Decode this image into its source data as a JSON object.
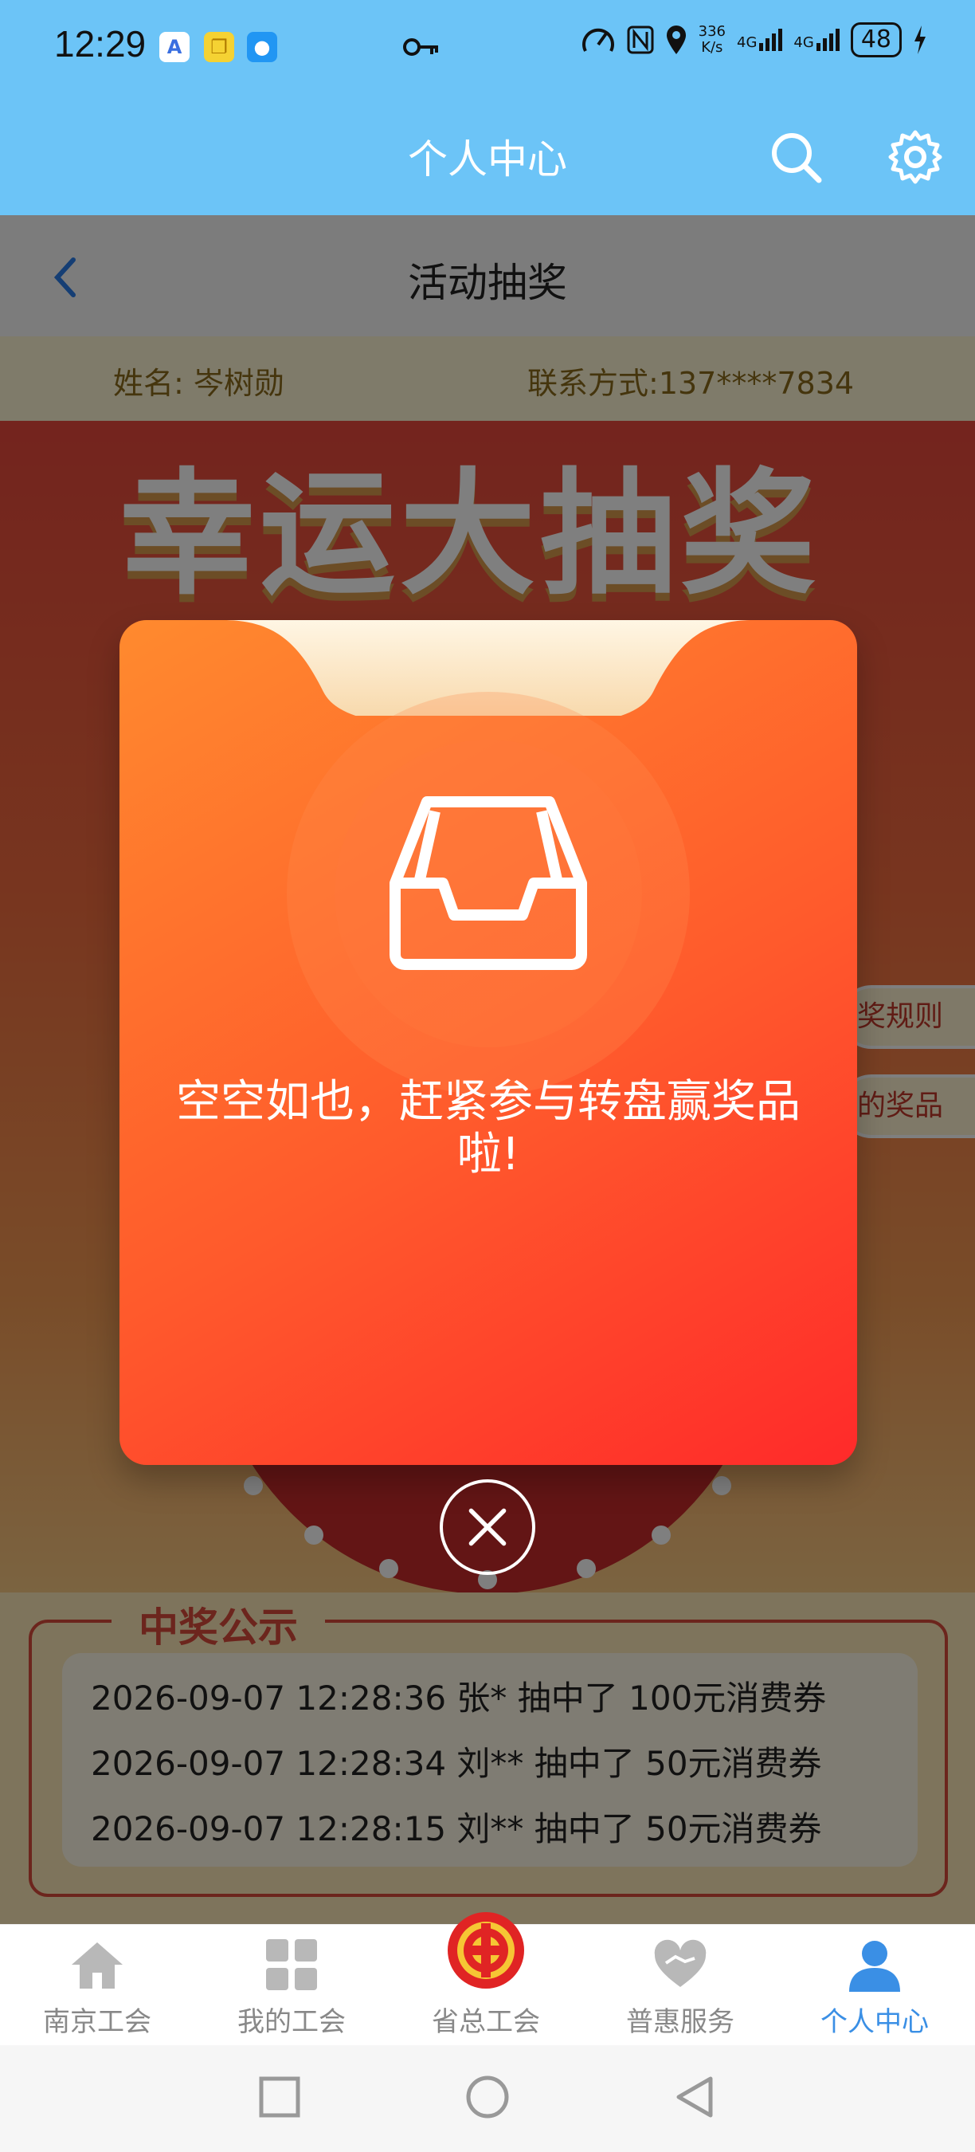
{
  "status_bar": {
    "time": "12:29",
    "speed_top": "336",
    "speed_bottom": "K/s",
    "network_1": "4G",
    "network_2": "4G",
    "battery": "48",
    "icons": [
      "app-a-icon",
      "app-copy-icon",
      "chat-bubble-icon",
      "key-icon",
      "speed-gauge-icon",
      "nfc-icon",
      "location-pin-icon",
      "signal-icon",
      "signal-icon",
      "charging-icon"
    ]
  },
  "app_bar": {
    "title": "个人中心",
    "icons": [
      "search-icon",
      "gear-icon"
    ]
  },
  "page": {
    "title": "活动抽奖",
    "user": {
      "name_label": "姓名:",
      "name_value": "岑树勋",
      "phone_label": "联系方式:",
      "phone_value": "137****7834"
    },
    "banner_title": "幸运大抽奖",
    "side_tabs": [
      "奖规则",
      "的奖品"
    ],
    "notice": {
      "title": "中奖公示",
      "items": [
        "2026-09-07 12:28:36 张* 抽中了 100元消费券",
        "2026-09-07 12:28:34 刘** 抽中了 50元消费券",
        "2026-09-07 12:28:15 刘** 抽中了 50元消费券"
      ]
    }
  },
  "modal": {
    "message": "空空如也，赶紧参与转盘赢奖品啦!",
    "icon": "empty-inbox-icon",
    "close_icon": "close-icon"
  },
  "tab_bar": {
    "items": [
      {
        "label": "南京工会",
        "icon": "house-icon"
      },
      {
        "label": "我的工会",
        "icon": "grid-icon"
      },
      {
        "label": "省总工会",
        "icon": "union-emblem-icon"
      },
      {
        "label": "普惠服务",
        "icon": "heart-hand-icon"
      },
      {
        "label": "个人中心",
        "icon": "person-icon"
      }
    ],
    "active_index": 4,
    "active_color": "#3a8fe5"
  },
  "colors": {
    "header": "#6cc4f7",
    "modal_start": "#ff8a2e",
    "modal_end": "#ff2a2a",
    "accent_red": "#d94a3b"
  }
}
